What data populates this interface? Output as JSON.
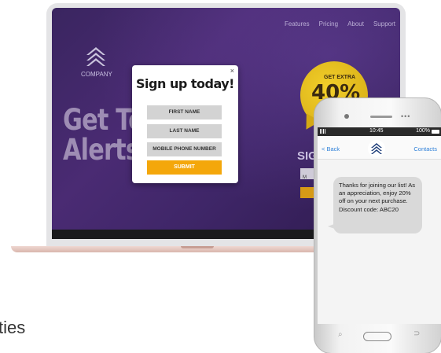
{
  "website": {
    "nav": [
      "Features",
      "Pricing",
      "About",
      "Support"
    ],
    "company": "COMPANY",
    "hero_line1": "Get Text",
    "hero_line2": "Alerts!",
    "badge_small": "GET EXTRA",
    "badge_big": "40%",
    "side_sign": "SIG",
    "side_box_label": "M"
  },
  "modal": {
    "title": "Sign up today!",
    "close": "×",
    "fields": [
      "FIRST NAME",
      "LAST NAME",
      "MOBILE PHONE NUMBER"
    ],
    "submit": "SUBMIT"
  },
  "background_text": "ties",
  "phone": {
    "time": "10:45",
    "battery": "100%",
    "back_label": "< Back",
    "contacts_label": "Contacts",
    "message": "Thanks for joining our list! As an appreciation, enjoy 20% off on your next purchase. Discount code: ABC20",
    "dots": "•••",
    "nav_search_glyph": "⌕",
    "nav_back_glyph": "⊃"
  },
  "colors": {
    "accent_blue": "#2f80d8",
    "submit_orange": "#f4a70b",
    "badge_yellow": "#f2cf2a"
  }
}
